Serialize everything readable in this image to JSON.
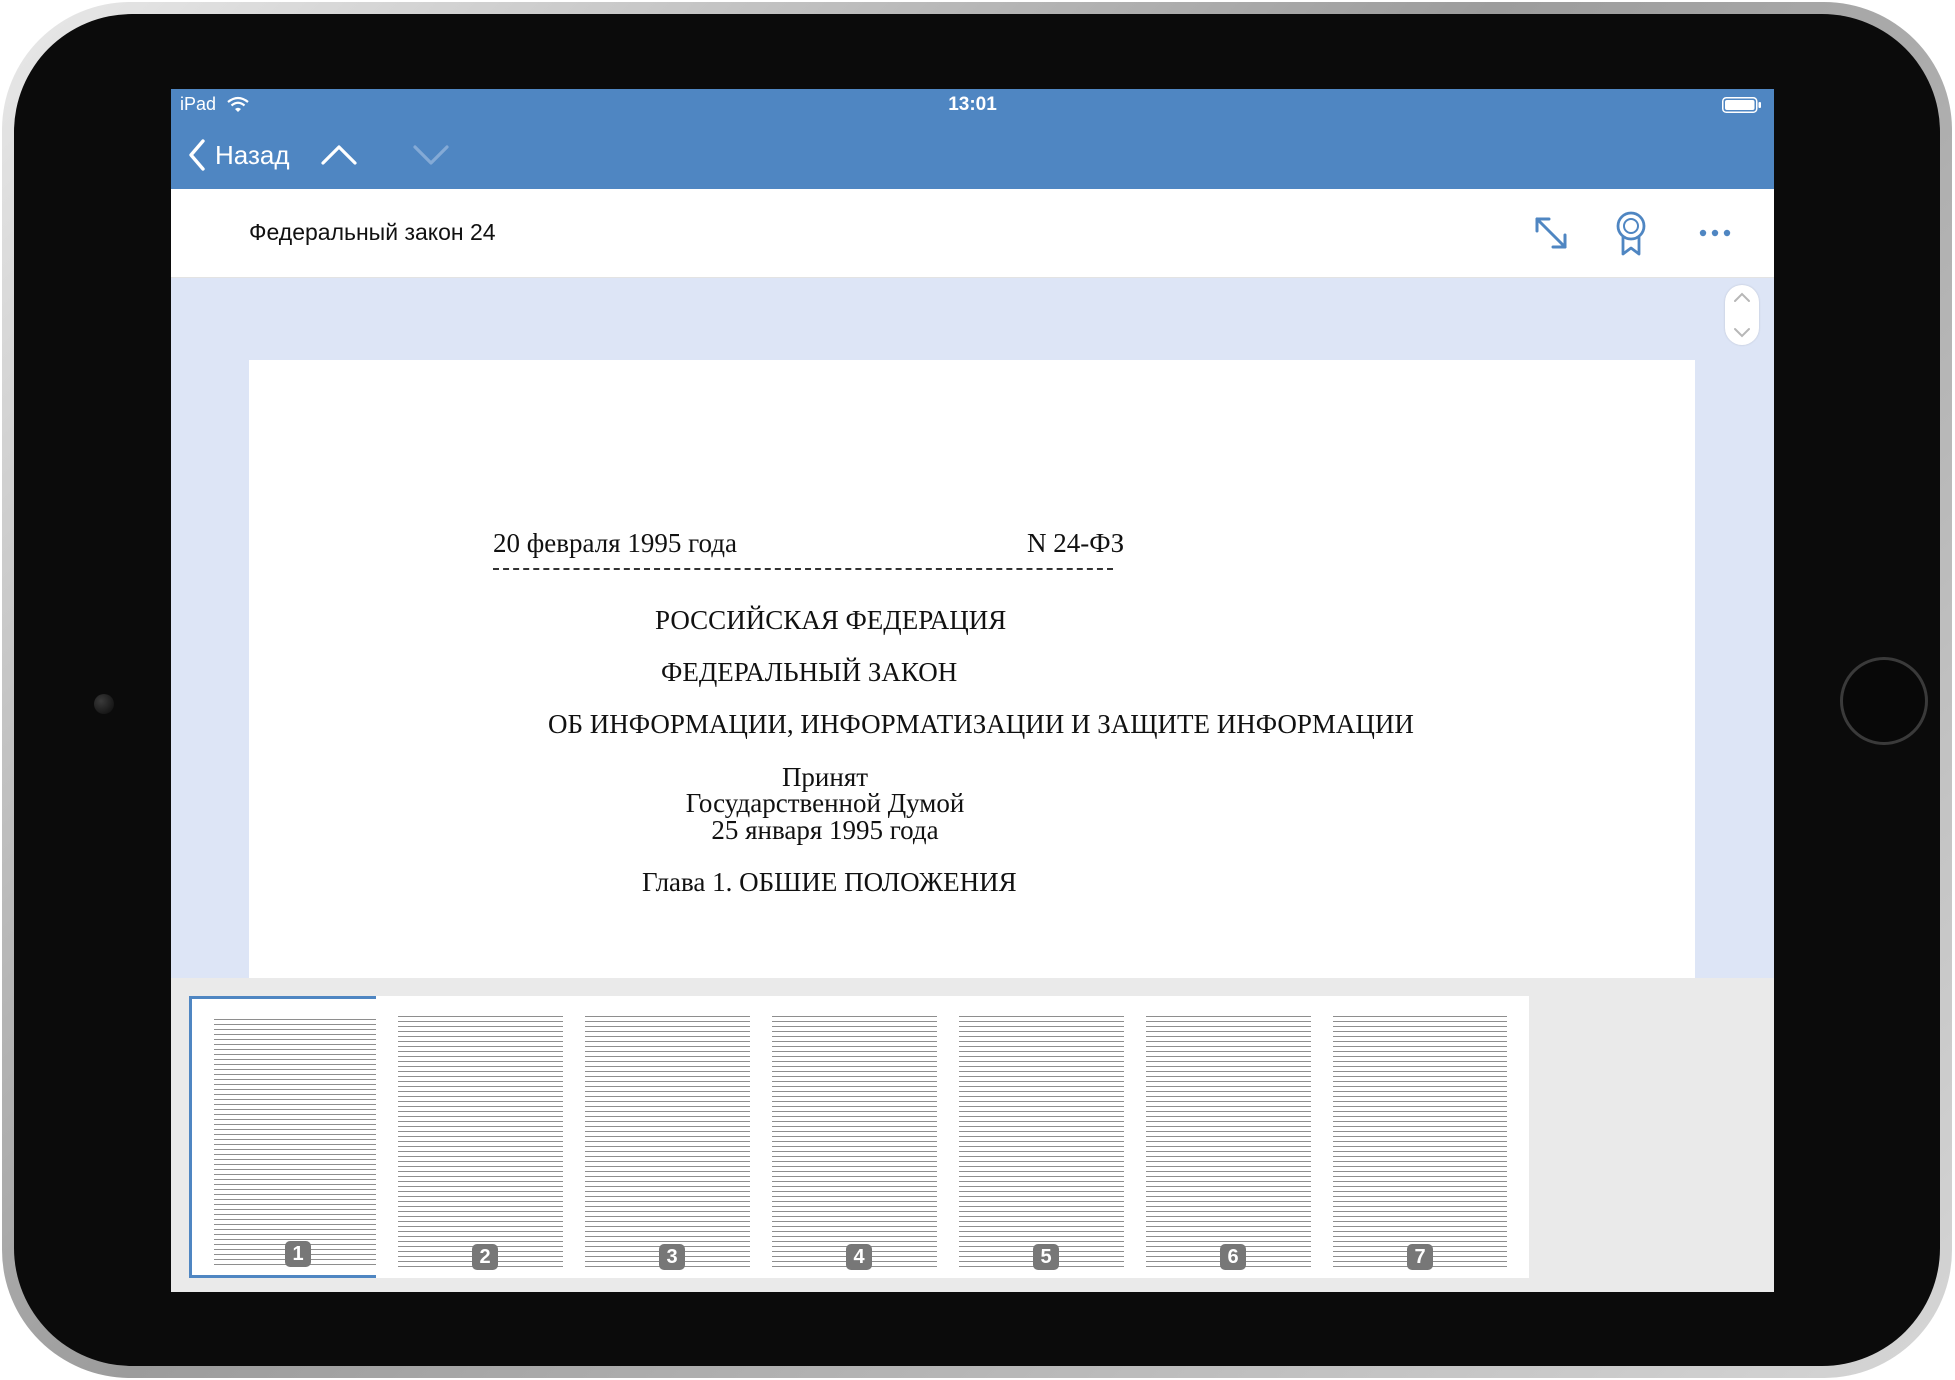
{
  "status_bar": {
    "carrier": "iPad",
    "time": "13:01"
  },
  "nav": {
    "back_label": "Назад"
  },
  "toolbar": {
    "title": "Федеральный закон 24"
  },
  "document": {
    "date": "20 февраля 1995 года",
    "number": "N 24-ФЗ",
    "line1": "РОССИЙСКАЯ ФЕДЕРАЦИЯ",
    "line2": "ФЕДЕРАЛЬНЫЙ ЗАКОН",
    "line3": "ОБ ИНФОРМАЦИИ, ИНФОРМАТИЗАЦИИ И ЗАЩИТЕ ИНФОРМАЦИИ",
    "accepted": "Принят",
    "by": "Государственной Думой",
    "accepted_date": "25 января 1995 года",
    "chapter": "Глава 1. ОБШИЕ ПОЛОЖЕНИЯ"
  },
  "thumbnails": [
    "1",
    "2",
    "3",
    "4",
    "5",
    "6",
    "7"
  ],
  "selected_page": "1",
  "colors": {
    "accent": "#4f86c2",
    "background": "#dde5f6"
  }
}
